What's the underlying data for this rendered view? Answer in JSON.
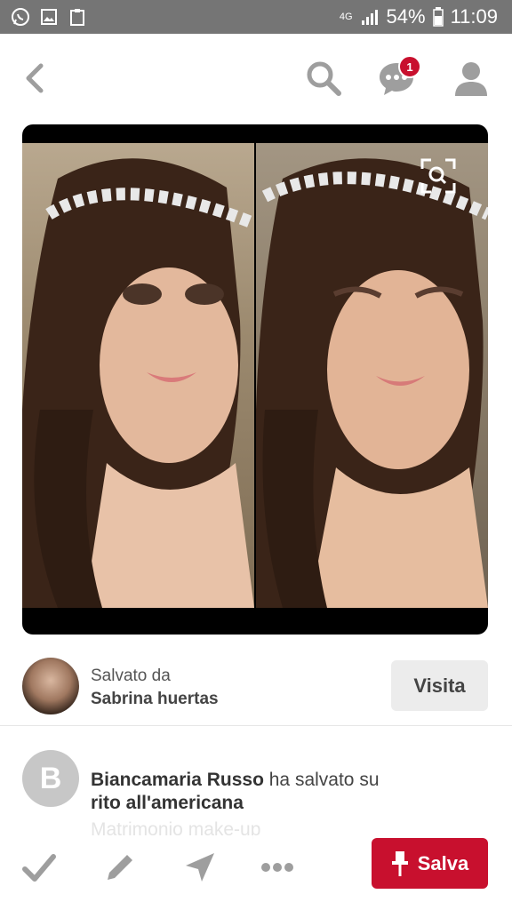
{
  "status_bar": {
    "network": "4G",
    "battery": "54%",
    "time": "11:09"
  },
  "nav": {
    "back_icon": "chevron-left-icon",
    "notifications_count": "1"
  },
  "pin": {
    "description_icons": [
      "expand-icon"
    ]
  },
  "saver": {
    "saved_by_label": "Salvato da",
    "name": "Sabrina huertas",
    "visit_label": "Visita"
  },
  "activity": {
    "avatar_letter": "B",
    "user_name": "Biancamaria Russo",
    "action_text": " ha salvato su",
    "board_name": "rito all'americana",
    "faded_text": "Matrimonio make-up"
  },
  "actions": {
    "save_label": "Salva"
  },
  "colors": {
    "status_bar": "#757575",
    "icon_gray": "#9e9e9e",
    "brand_red": "#c8102e"
  }
}
